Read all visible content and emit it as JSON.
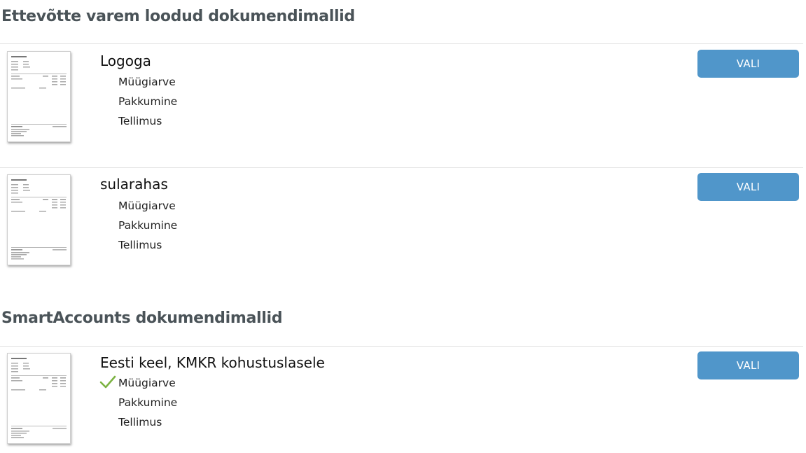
{
  "sections": [
    {
      "title": "Ettevõtte varem loodud dokumendimallid",
      "templates": [
        {
          "name": "Logoga",
          "docs": [
            {
              "label": "Müügiarve",
              "checked": false
            },
            {
              "label": "Pakkumine",
              "checked": false
            },
            {
              "label": "Tellimus",
              "checked": false
            }
          ],
          "button": "VALI"
        },
        {
          "name": "sularahas",
          "docs": [
            {
              "label": "Müügiarve",
              "checked": false
            },
            {
              "label": "Pakkumine",
              "checked": false
            },
            {
              "label": "Tellimus",
              "checked": false
            }
          ],
          "button": "VALI"
        }
      ]
    },
    {
      "title": "SmartAccounts dokumendimallid",
      "templates": [
        {
          "name": "Eesti keel, KMKR kohustuslasele",
          "docs": [
            {
              "label": "Müügiarve",
              "checked": true
            },
            {
              "label": "Pakkumine",
              "checked": false
            },
            {
              "label": "Tellimus",
              "checked": false
            }
          ],
          "button": "VALI"
        }
      ]
    }
  ],
  "colors": {
    "button_bg": "#5096ca",
    "check": "#7cb342",
    "section_title": "#4a5358"
  },
  "icons": {
    "check": "check-icon",
    "thumbnail": "document-thumbnail"
  }
}
